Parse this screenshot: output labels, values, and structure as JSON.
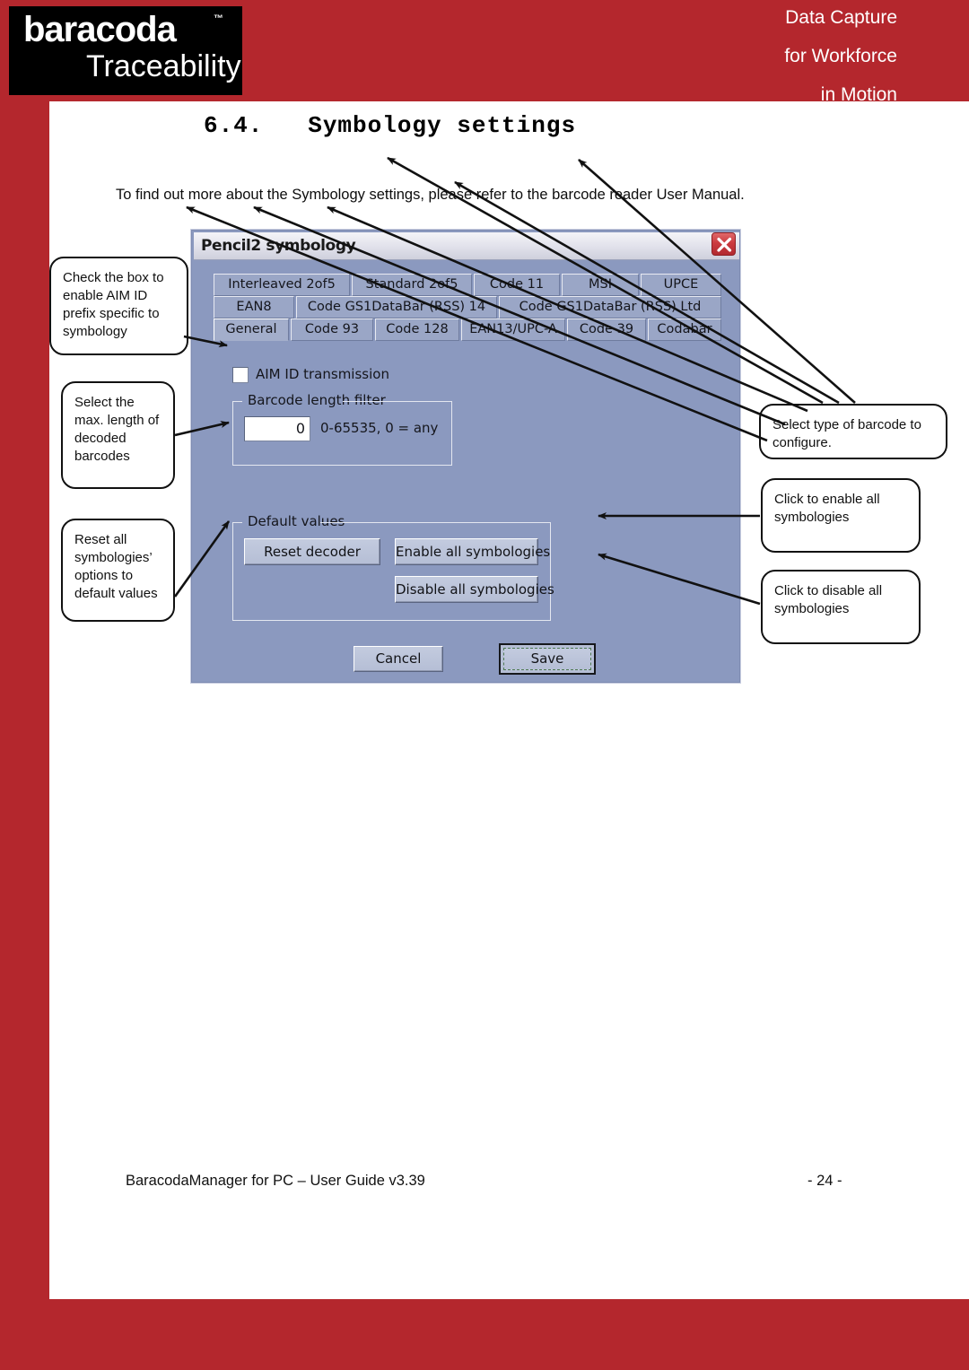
{
  "header": {
    "logo_main": "baracoda",
    "logo_tm": "™",
    "logo_sub": "Traceability",
    "tagline": [
      "Data Capture",
      "for Workforce",
      "in Motion"
    ],
    "brand_red": "#b4272d"
  },
  "section": {
    "heading": "6.4.   Symbology settings",
    "intro": "To find out more about the Symbology settings, please refer to the barcode reader User Manual."
  },
  "dialog": {
    "title": "Pencil2 symbology",
    "close_icon": "close-icon",
    "tabs_row1": [
      "Interleaved 2of5",
      "Standard 2of5",
      "Code 11",
      "MSI",
      "UPCE"
    ],
    "tabs_row2": [
      "EAN8",
      "Code GS1DataBar (RSS) 14",
      "Code GS1DataBar (RSS) Ltd"
    ],
    "tabs_row3": [
      "General",
      "Code 93",
      "Code 128",
      "EAN13/UPC-A",
      "Code 39",
      "Codabar"
    ],
    "active_tab": "General",
    "checkbox": {
      "label": "AIM ID transmission",
      "checked": false
    },
    "barcode_length_filter": {
      "group_title": "Barcode length filter",
      "value": "0",
      "hint": "0-65535, 0 = any"
    },
    "default_values": {
      "group_title": "Default values",
      "reset_decoder": "Reset decoder",
      "enable_all": "Enable all symbologies",
      "disable_all": "Disable all symbologies"
    },
    "cancel": "Cancel",
    "save": "Save",
    "colors": {
      "dialog_bg": "#8b99bf",
      "tab_bg": "#9aa6c6",
      "button_bg": "#b5bed5",
      "close_red": "#cb3b40"
    }
  },
  "callouts": {
    "aim_id": "Check the box to enable AIM ID prefix specific to symbology",
    "max_length": "Select the max. length of decoded barcodes",
    "reset_all": "Reset all symbologies’ options  to default values",
    "select_type": "Select type of barcode to configure.",
    "enable_all": "Click to enable all symbologies",
    "disable_all": "Click to disable all symbologies"
  },
  "footer": {
    "left": "BaracodaManager for PC – User Guide v3.39",
    "page": "- 24 -"
  }
}
